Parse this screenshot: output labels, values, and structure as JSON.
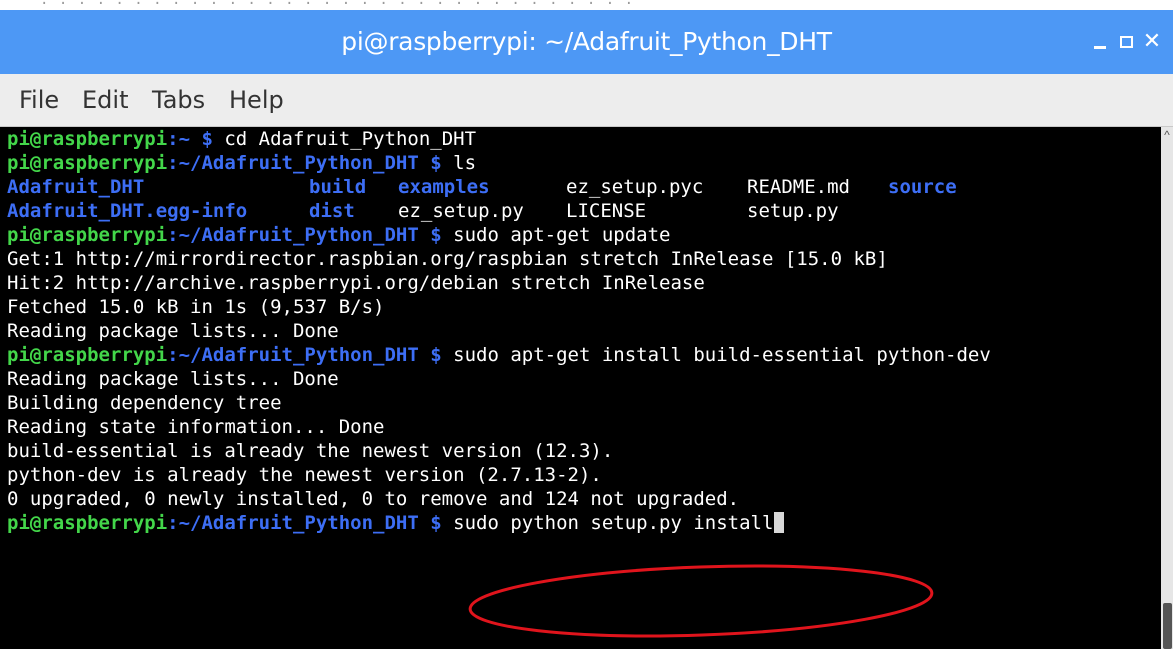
{
  "window": {
    "title": "pi@raspberrypi: ~/Adafruit_Python_DHT"
  },
  "menu": {
    "file": "File",
    "edit": "Edit",
    "tabs": "Tabs",
    "help": "Help"
  },
  "terminal": {
    "prompt_user": "pi@raspberrypi",
    "prompt_home": ":~ $ ",
    "prompt_dir": ":~/Adafruit_Python_DHT $ ",
    "cmd_cd": "cd Adafruit_Python_DHT",
    "cmd_ls": "ls",
    "ls_row1": {
      "c1": "Adafruit_DHT",
      "c2": "build",
      "c3": "examples",
      "c4": "ez_setup.pyc",
      "c5": "README.md",
      "c6": "source"
    },
    "ls_row2": {
      "c1": "Adafruit_DHT.egg-info",
      "c2": "dist",
      "c3": "ez_setup.py",
      "c4": "LICENSE",
      "c5": "setup.py"
    },
    "cmd_update": "sudo apt-get update",
    "out_get1": "Get:1 http://mirrordirector.raspbian.org/raspbian stretch InRelease [15.0 kB]",
    "out_hit2": "Hit:2 http://archive.raspberrypi.org/debian stretch InRelease",
    "out_fetched": "Fetched 15.0 kB in 1s (9,537 B/s)",
    "out_reading1": "Reading package lists... Done",
    "cmd_install": "sudo apt-get install build-essential python-dev",
    "out_reading2": "Reading package lists... Done",
    "out_building": "Building dependency tree",
    "out_state": "Reading state information... Done",
    "out_build_essential": "build-essential is already the newest version (12.3).",
    "out_python_dev": "python-dev is already the newest version (2.7.13-2).",
    "out_upgraded": "0 upgraded, 0 newly installed, 0 to remove and 124 not upgraded.",
    "cmd_setup": "sudo python setup.py install"
  },
  "colors": {
    "titlebar": "#4d98f5",
    "prompt_user": "#43d64a",
    "prompt_dir": "#3d6ef5",
    "annotation": "#e0141c"
  },
  "icons": {
    "minimize": "minimize-icon",
    "maximize": "maximize-icon",
    "close": "close-icon"
  }
}
